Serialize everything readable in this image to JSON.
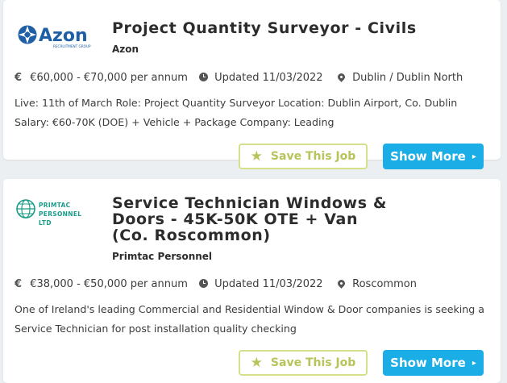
{
  "jobs": [
    {
      "logo": {
        "name": "Azon",
        "tagline": "RECRUITMENT GROUP",
        "color": "#1f5fa6"
      },
      "title": "Project Quantity Surveyor - Civils",
      "company": "Azon",
      "salary": "€60,000 - €70,000 per annum",
      "updated": "Updated 11/03/2022",
      "location": "Dublin  / Dublin North",
      "description": "Live: 11th of March Role: Project Quantity Surveyor Location: Dublin Airport, Co. Dublin Salary: €60-70K (DOE) + Vehicle + Package Company: Leading",
      "save_label": "Save This Job",
      "more_label": "Show More"
    },
    {
      "logo": {
        "name": "PRIMTAC PERSONNEL LTD",
        "color": "#1a9c8a"
      },
      "title": "Service Technician Windows & Doors - 45K-50K OTE + Van (Co. Roscommon)",
      "company": "Primtac Personnel",
      "salary": "€38,000 - €50,000 per annum",
      "updated": "Updated 11/03/2022",
      "location": "Roscommon",
      "description": "One of Ireland's leading Commercial and Residential Window & Door companies is seeking a Service Technician for post installation quality checking",
      "save_label": "Save This Job",
      "more_label": "Show More"
    }
  ],
  "icons": {
    "currency": "€",
    "star": "★",
    "caret": "▸"
  },
  "colors": {
    "accent": "#1baee6",
    "save_border": "#d6e08a",
    "save_text": "#b8c35a",
    "background": "#eceff1"
  }
}
